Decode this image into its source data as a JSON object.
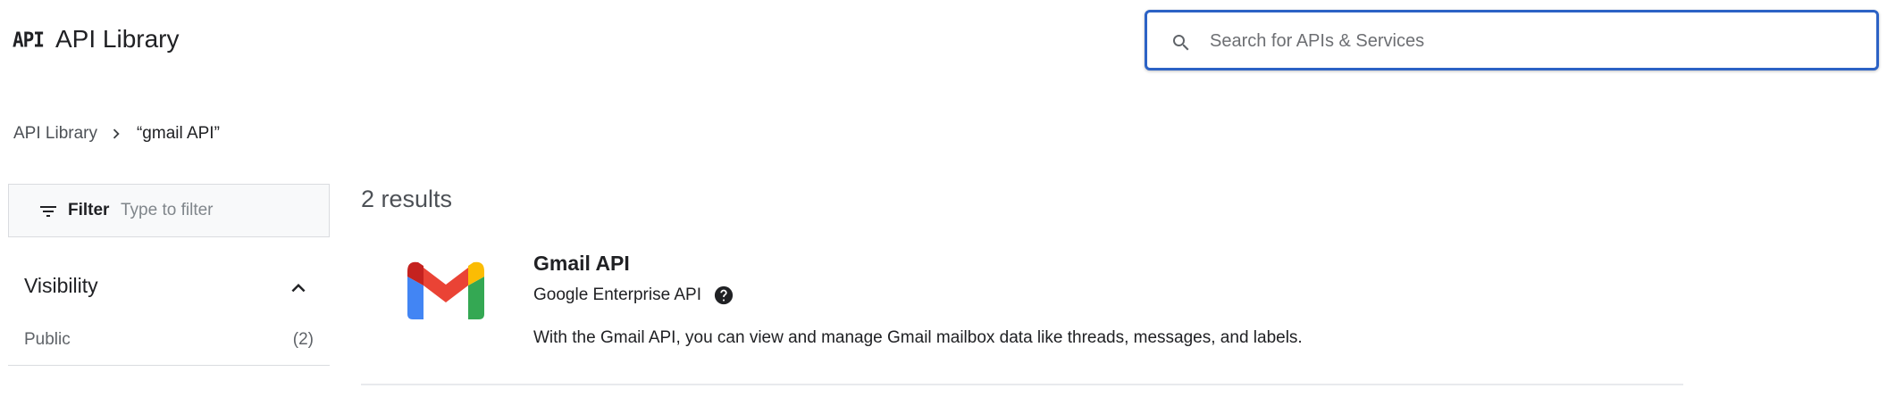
{
  "header": {
    "logo_text": "API",
    "title": "API Library",
    "search": {
      "placeholder": "Search for APIs & Services",
      "value": "",
      "icon": "search-icon",
      "accent_color": "#2c62c5"
    }
  },
  "breadcrumb": {
    "root": "API Library",
    "separator_icon": "chevron-right-icon",
    "current": "“gmail API”"
  },
  "sidebar": {
    "filter": {
      "icon": "filter-list-icon",
      "label": "Filter",
      "placeholder": "Type to filter",
      "value": ""
    },
    "sections": [
      {
        "title": "Visibility",
        "toggle_icon": "chevron-up-icon",
        "expanded": true,
        "options": [
          {
            "label": "Public",
            "count": "(2)"
          }
        ]
      }
    ]
  },
  "results": {
    "count_text": "2 results",
    "items": [
      {
        "logo": "gmail-logo",
        "name": "Gmail API",
        "provider": "Google Enterprise API",
        "help_icon": "help-icon",
        "description": "With the Gmail API, you can view and manage Gmail mailbox data like threads, messages, and labels."
      }
    ]
  }
}
